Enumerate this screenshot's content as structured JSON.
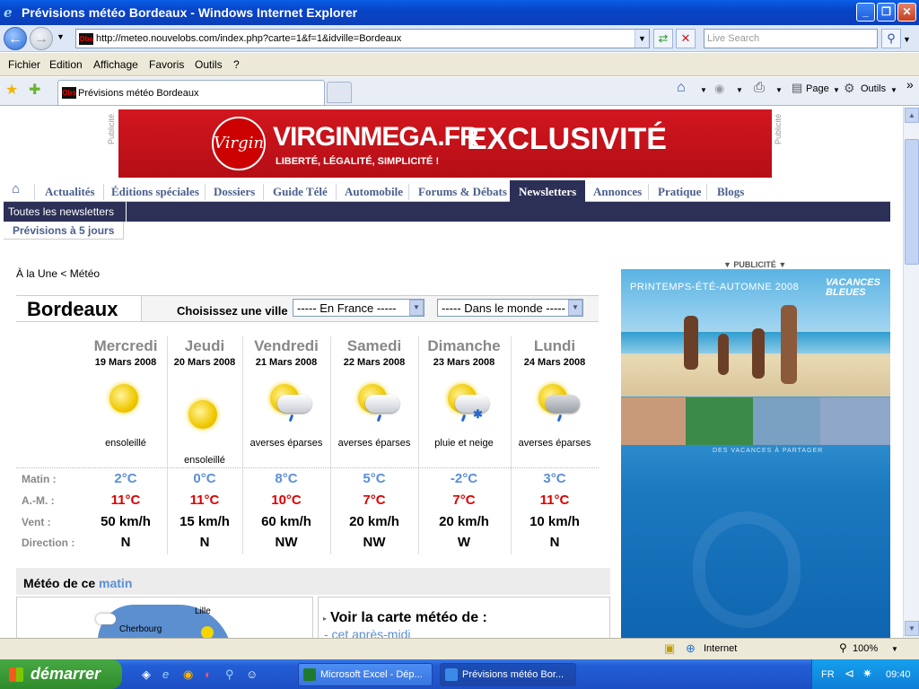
{
  "window": {
    "title": "Prévisions météo Bordeaux - Windows Internet Explorer",
    "ie_icon": "e"
  },
  "address": {
    "url": "http://meteo.nouvelobs.com/index.php?carte=1&f=1&idville=Bordeaux",
    "favicon_text": "Obs"
  },
  "search": {
    "placeholder": "Live Search"
  },
  "menu": [
    "Fichier",
    "Edition",
    "Affichage",
    "Favoris",
    "Outils",
    "?"
  ],
  "tab": {
    "label": "Prévisions météo Bordeaux"
  },
  "toolbar": {
    "page": "Page",
    "tools": "Outils",
    "more": "»"
  },
  "banner": {
    "logo": "Virgin",
    "brand": "VIRGINMEGA.FR",
    "tagline": "LIBERTÉ, LÉGALITÉ, SIMPLICITÉ !",
    "headline": "EXCLUSIVITÉ",
    "pub_label": "Publicité"
  },
  "nav": {
    "items": [
      "Actualités",
      "Éditions spéciales",
      "Dossiers",
      "Guide Télé",
      "Automobile",
      "Forums & Débats",
      "Newsletters",
      "Annonces",
      "Pratique",
      "Blogs"
    ],
    "active": "Newsletters",
    "sub": "Toutes les newsletters",
    "sub2": "Prévisions à 5 jours"
  },
  "breadcrumb": "À la Une < Météo",
  "city": "Bordeaux",
  "choose_label": "Choisissez une ville",
  "select_france": "----- En France -----",
  "select_world": "----- Dans le monde -----",
  "row_labels": {
    "morning": "Matin :",
    "afternoon": "A.-M. :",
    "wind": "Vent :",
    "direction": "Direction :"
  },
  "days": [
    {
      "name": "Mercredi",
      "date": "19 Mars 2008",
      "cond": "ensoleillé",
      "min": "2°C",
      "max": "11°C",
      "wind": "50 km/h",
      "dir": "N",
      "icon": "sun-icon"
    },
    {
      "name": "Jeudi",
      "date": "20 Mars 2008",
      "cond": "ensoleillé",
      "min": "0°C",
      "max": "11°C",
      "wind": "15 km/h",
      "dir": "N",
      "icon": "sun-icon"
    },
    {
      "name": "Vendredi",
      "date": "21 Mars 2008",
      "cond": "averses éparses",
      "min": "8°C",
      "max": "10°C",
      "wind": "60 km/h",
      "dir": "NW",
      "icon": "sun-cloud-rain-icon"
    },
    {
      "name": "Samedi",
      "date": "22 Mars 2008",
      "cond": "averses éparses",
      "min": "5°C",
      "max": "7°C",
      "wind": "20 km/h",
      "dir": "NW",
      "icon": "sun-cloud-rain-icon"
    },
    {
      "name": "Dimanche",
      "date": "23 Mars 2008",
      "cond": "pluie et neige",
      "min": "-2°C",
      "max": "7°C",
      "wind": "20 km/h",
      "dir": "W",
      "icon": "sun-cloud-snow-icon"
    },
    {
      "name": "Lundi",
      "date": "24 Mars 2008",
      "cond": "averses éparses",
      "min": "3°C",
      "max": "11°C",
      "wind": "10 km/h",
      "dir": "N",
      "icon": "sun-cloud-rain-icon"
    }
  ],
  "matin": {
    "prefix": "Météo de ce",
    "highlight": "matin"
  },
  "map": {
    "cities": [
      "Lille",
      "Cherbourg"
    ]
  },
  "see_map": {
    "title": "Voir la carte météo de :",
    "link": "- cet après-midi"
  },
  "ad_right": {
    "pub_label": "▼ PUBLICITÉ ▼",
    "header": "PRINTEMPS-ÉTÉ-AUTOMNE 2008",
    "brand": "VACANCES BLEUES",
    "sub": "DES VACANCES À PARTAGER"
  },
  "status": {
    "zone": "Internet",
    "zoom": "100%"
  },
  "taskbar": {
    "start": "démarrer",
    "tasks": [
      "Microsoft Excel - Dép...",
      "Prévisions météo Bor..."
    ],
    "lang": "FR",
    "clock": "09:40"
  }
}
